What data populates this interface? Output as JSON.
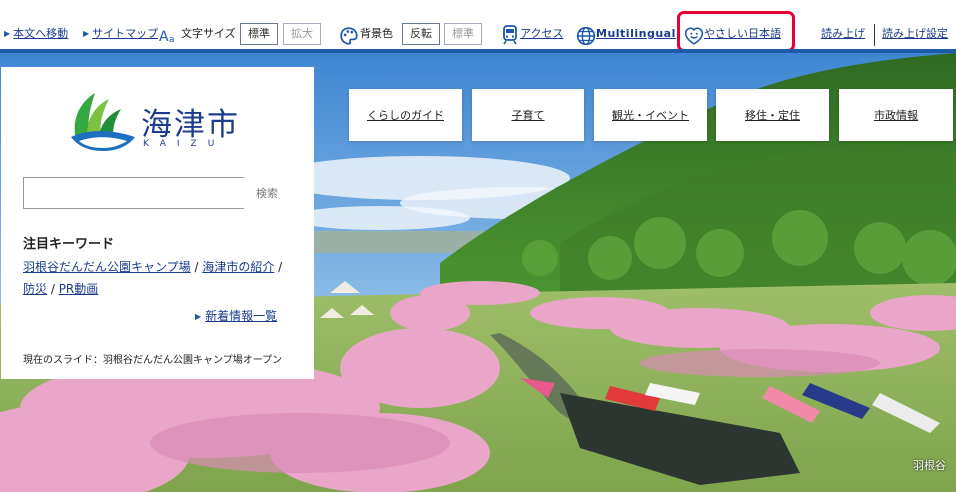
{
  "topbar": {
    "skip_link": "本文へ移動",
    "sitemap_link": "サイトマップ",
    "font_size_label": "文字サイズ",
    "font_standard": "標準",
    "font_enlarge": "拡大",
    "bg_color_label": "背景色",
    "bg_invert": "反転",
    "bg_standard": "標準",
    "access_link": "アクセス",
    "multilingual_link": "Multilingual",
    "easy_japanese_link": "やさしい日本語",
    "read_aloud_link": "読み上げ",
    "read_aloud_settings_link": "読み上げ設定",
    "accent_color": "#1d5aa8",
    "highlight_color": "#e60033"
  },
  "nav": {
    "items": [
      "くらしのガイド",
      "子育て",
      "観光・イベント",
      "移住・定住",
      "市政情報"
    ]
  },
  "logo": {
    "kanji": "海津市",
    "roman": "KAIZU"
  },
  "search": {
    "placeholder": "",
    "button_label": "検索"
  },
  "keywords": {
    "heading": "注目キーワード",
    "items": [
      "羽根谷だんだん公園キャンプ場",
      "海津市の紹介",
      "防災",
      "PR動画"
    ],
    "separator": " / "
  },
  "news": {
    "link_label": "新着情報一覧"
  },
  "slide": {
    "current_label": "現在のスライド：羽根谷だんだん公園キャンプ場オープン"
  },
  "hero": {
    "caption": "羽根谷"
  }
}
